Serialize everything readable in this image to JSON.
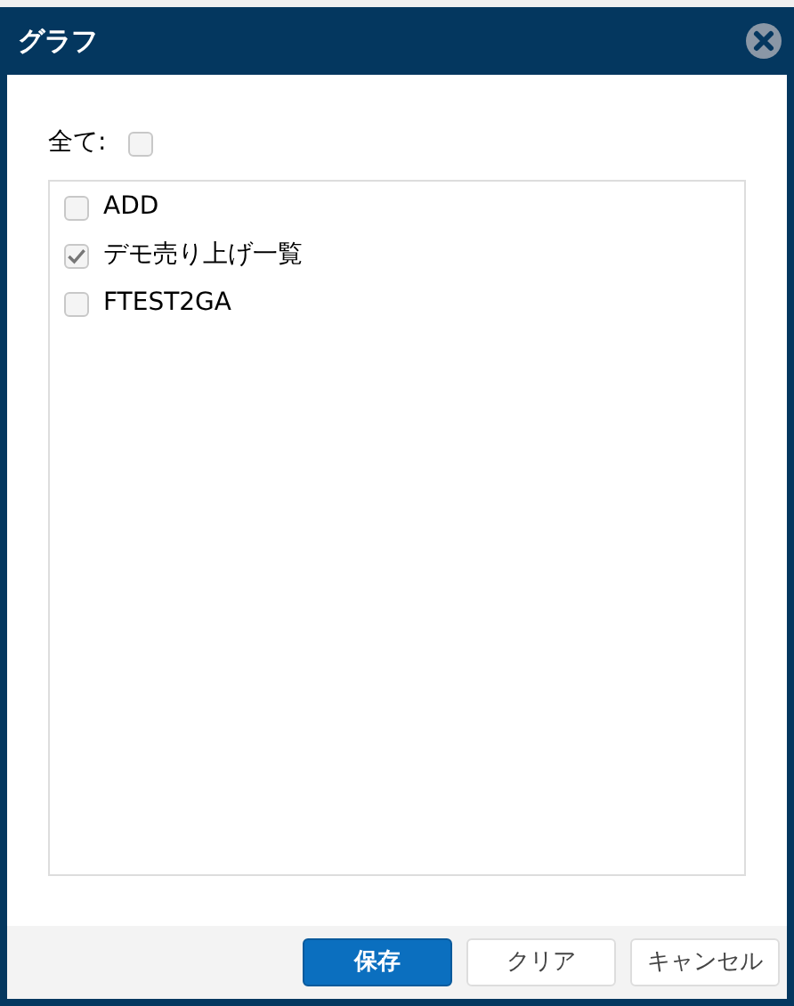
{
  "window": {
    "title": "グラフ"
  },
  "select_all": {
    "label": "全て:",
    "checked": false
  },
  "items": [
    {
      "label": "ADD",
      "checked": false
    },
    {
      "label": "デモ売り上げ一覧",
      "checked": true
    },
    {
      "label": "FTEST2GA",
      "checked": false
    }
  ],
  "buttons": [
    {
      "label": "保存",
      "kind": "primary"
    },
    {
      "label": "クリア",
      "kind": "default"
    },
    {
      "label": "キャンセル",
      "kind": "default"
    }
  ]
}
